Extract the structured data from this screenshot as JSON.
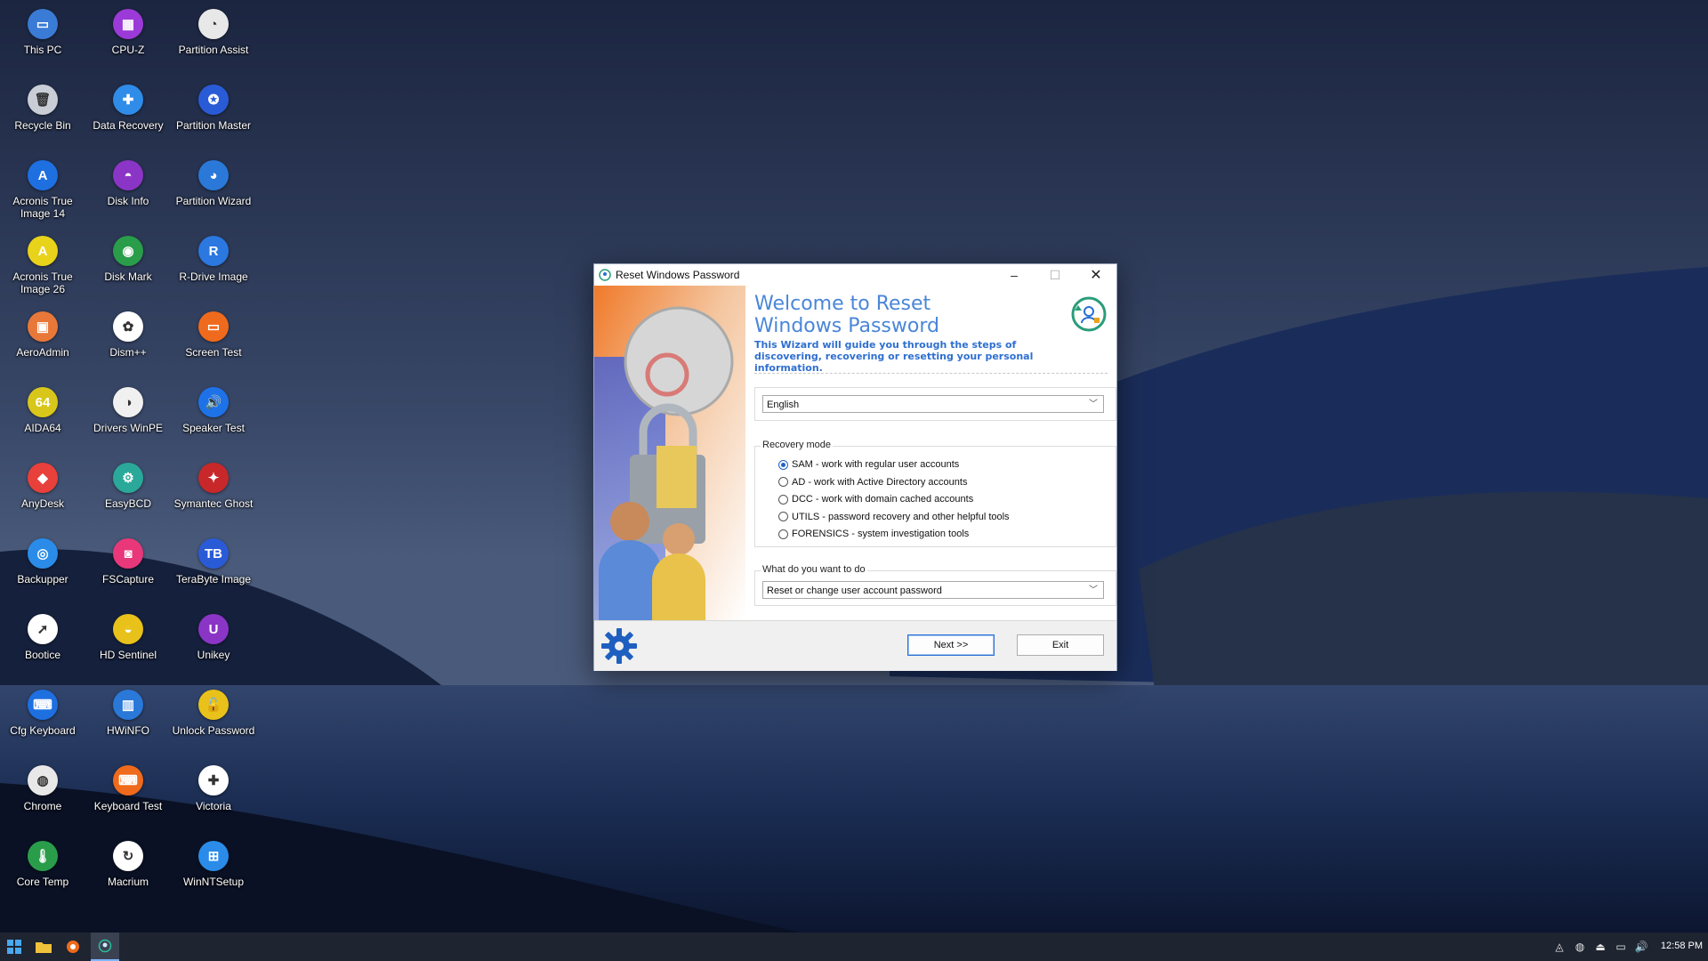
{
  "desktop": {
    "icons": [
      {
        "label": "This PC",
        "icon": "computer-icon",
        "color": "#3a7bd5",
        "glyph": "▭"
      },
      {
        "label": "CPU-Z",
        "icon": "cpu-icon",
        "color": "#9b3ad8",
        "glyph": "▦"
      },
      {
        "label": "Partition Assist",
        "icon": "partition-assist-icon",
        "color": "#e8e8e8",
        "glyph": "◔"
      },
      {
        "label": "Recycle Bin",
        "icon": "recycle-bin-icon",
        "color": "#c9ced6",
        "glyph": "🗑"
      },
      {
        "label": "Data Recovery",
        "icon": "data-recovery-icon",
        "color": "#2f8ce8",
        "glyph": "✚"
      },
      {
        "label": "Partition Master",
        "icon": "partition-master-icon",
        "color": "#2a5bd7",
        "glyph": "✪"
      },
      {
        "label": "Acronis True Image 14",
        "icon": "acronis-14-icon",
        "color": "#1e6fe0",
        "glyph": "A"
      },
      {
        "label": "Disk Info",
        "icon": "disk-info-icon",
        "color": "#8b35c6",
        "glyph": "◓"
      },
      {
        "label": "Partition Wizard",
        "icon": "partition-wizard-icon",
        "color": "#2a78d8",
        "glyph": "◕"
      },
      {
        "label": "Acronis True Image 26",
        "icon": "acronis-26-icon",
        "color": "#e8d21a",
        "glyph": "A"
      },
      {
        "label": "Disk Mark",
        "icon": "disk-mark-icon",
        "color": "#2a9d4a",
        "glyph": "◉"
      },
      {
        "label": "R-Drive Image",
        "icon": "r-drive-icon",
        "color": "#2a78e0",
        "glyph": "R"
      },
      {
        "label": "AeroAdmin",
        "icon": "aeroadmin-icon",
        "color": "#e8783a",
        "glyph": "▣"
      },
      {
        "label": "Dism++",
        "icon": "dism-icon",
        "color": "#ffffff",
        "glyph": "✿"
      },
      {
        "label": "Screen Test",
        "icon": "screen-test-icon",
        "color": "#ef6a1c",
        "glyph": "▭"
      },
      {
        "label": "AIDA64",
        "icon": "aida64-icon",
        "color": "#d8c71a",
        "glyph": "64"
      },
      {
        "label": "Drivers WinPE",
        "icon": "drivers-winpe-icon",
        "color": "#f0f0f0",
        "glyph": "◑"
      },
      {
        "label": "Speaker Test",
        "icon": "speaker-test-icon",
        "color": "#1e72e8",
        "glyph": "🔊"
      },
      {
        "label": "AnyDesk",
        "icon": "anydesk-icon",
        "color": "#e8403a",
        "glyph": "◆"
      },
      {
        "label": "EasyBCD",
        "icon": "easybcd-icon",
        "color": "#2aa89a",
        "glyph": "⚙"
      },
      {
        "label": "Symantec Ghost",
        "icon": "symantec-ghost-icon",
        "color": "#c8282a",
        "glyph": "✦"
      },
      {
        "label": "Backupper",
        "icon": "backupper-icon",
        "color": "#2a8ce8",
        "glyph": "◎"
      },
      {
        "label": "FSCapture",
        "icon": "fscapture-icon",
        "color": "#e8387a",
        "glyph": "◙"
      },
      {
        "label": "TeraByte Image",
        "icon": "terabyte-image-icon",
        "color": "#2a5bd7",
        "glyph": "TB"
      },
      {
        "label": "Bootice",
        "icon": "bootice-icon",
        "color": "#ffffff",
        "glyph": "➚"
      },
      {
        "label": "HD Sentinel",
        "icon": "hd-sentinel-icon",
        "color": "#e8c21a",
        "glyph": "◒"
      },
      {
        "label": "Unikey",
        "icon": "unikey-icon",
        "color": "#8a35c6",
        "glyph": "U"
      },
      {
        "label": "Cfg Keyboard",
        "icon": "cfg-keyboard-icon",
        "color": "#1e6fe0",
        "glyph": "⌨"
      },
      {
        "label": "HWiNFO",
        "icon": "hwinfo-icon",
        "color": "#2a78d8",
        "glyph": "▥"
      },
      {
        "label": "Unlock Password",
        "icon": "unlock-password-icon",
        "color": "#e8c21a",
        "glyph": "🔓"
      },
      {
        "label": "Chrome",
        "icon": "chrome-icon",
        "color": "#e8e8e8",
        "glyph": "◍"
      },
      {
        "label": "Keyboard Test",
        "icon": "keyboard-test-icon",
        "color": "#ef6a1c",
        "glyph": "⌨"
      },
      {
        "label": "Victoria",
        "icon": "victoria-icon",
        "color": "#ffffff",
        "glyph": "✚"
      },
      {
        "label": "Core Temp",
        "icon": "core-temp-icon",
        "color": "#2a9d4a",
        "glyph": "🌡"
      },
      {
        "label": "Macrium",
        "icon": "macrium-icon",
        "color": "#ffffff",
        "glyph": "↻"
      },
      {
        "label": "WinNTSetup",
        "icon": "winntsetup-icon",
        "color": "#2a8ce8",
        "glyph": "⊞"
      }
    ]
  },
  "dialog": {
    "title": "Reset Windows Password",
    "welcome_title": "Welcome to Reset Windows Password",
    "welcome_sub": "This Wizard will guide you through the steps of discovering, recovering or resetting your personal information.",
    "language": {
      "value": "English"
    },
    "recovery_mode": {
      "label": "Recovery mode",
      "options": [
        {
          "label": "SAM - work with regular user accounts",
          "selected": true
        },
        {
          "label": "AD - work with Active Directory accounts",
          "selected": false
        },
        {
          "label": "DCC - work with domain cached accounts",
          "selected": false
        },
        {
          "label": "UTILS - password recovery and other helpful tools",
          "selected": false
        },
        {
          "label": "FORENSICS - system investigation tools",
          "selected": false
        }
      ]
    },
    "action": {
      "label": "What do you want to do",
      "value": "Reset or change user account password"
    },
    "buttons": {
      "next": "Next >>",
      "exit": "Exit"
    },
    "accent": "#4a86d8"
  },
  "taskbar": {
    "clock": "12:58 PM"
  }
}
